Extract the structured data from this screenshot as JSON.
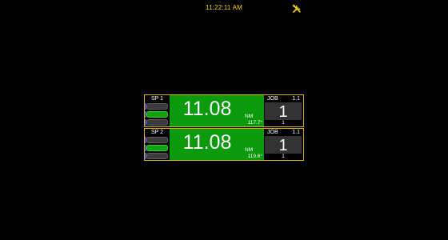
{
  "header": {
    "time": "11:22:11 AM",
    "tools_icon": "tools-icon",
    "accent_color": "#f5d400"
  },
  "spindles": [
    {
      "label": "SP 1",
      "torque": "11.08",
      "unit": "NM",
      "angle": "117.7°",
      "job_label": "JOB",
      "job_version": "1.1",
      "job_number": "1",
      "job_count": "1",
      "status_bars": [
        "off",
        "on",
        "off"
      ]
    },
    {
      "label": "SP 2",
      "torque": "11.08",
      "unit": "NM",
      "angle": "119.6°",
      "job_label": "JOB",
      "job_version": "1.1",
      "job_number": "1",
      "job_count": "1",
      "status_bars": [
        "off",
        "on",
        "off"
      ]
    }
  ],
  "colors": {
    "ok_green": "#0b9a0b",
    "frame": "#d9b200",
    "job_box": "#333333"
  }
}
